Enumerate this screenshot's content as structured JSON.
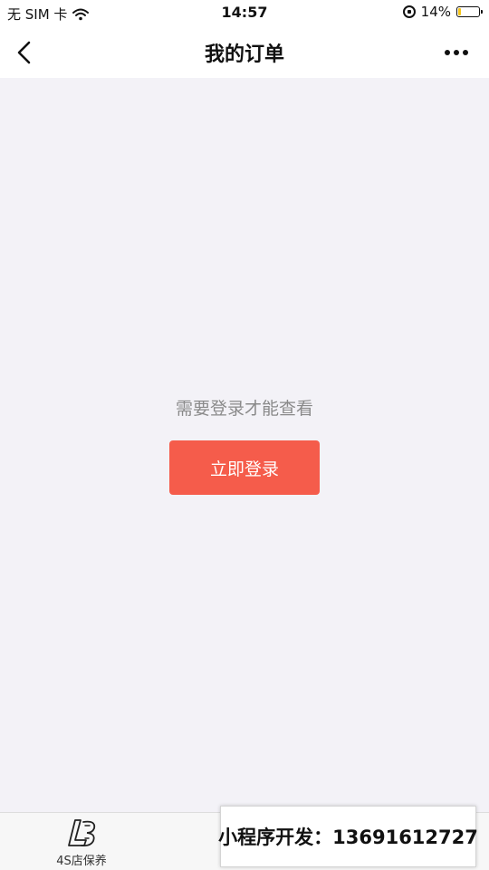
{
  "status_bar": {
    "carrier": "无 SIM 卡",
    "time": "14:57",
    "battery": "14%",
    "battery_level": 0.14
  },
  "nav": {
    "title": "我的订单"
  },
  "main": {
    "prompt": "需要登录才能查看",
    "login_button": "立即登录"
  },
  "tab_bar": {
    "items": [
      {
        "label": "4S店保养",
        "icon": "shop-logo-icon"
      }
    ]
  },
  "overlay": {
    "dev_text": "小程序开发：13691612727"
  },
  "colors": {
    "accent": "#f55c4b",
    "background": "#f3f2f7",
    "battery": "#f5c518"
  }
}
